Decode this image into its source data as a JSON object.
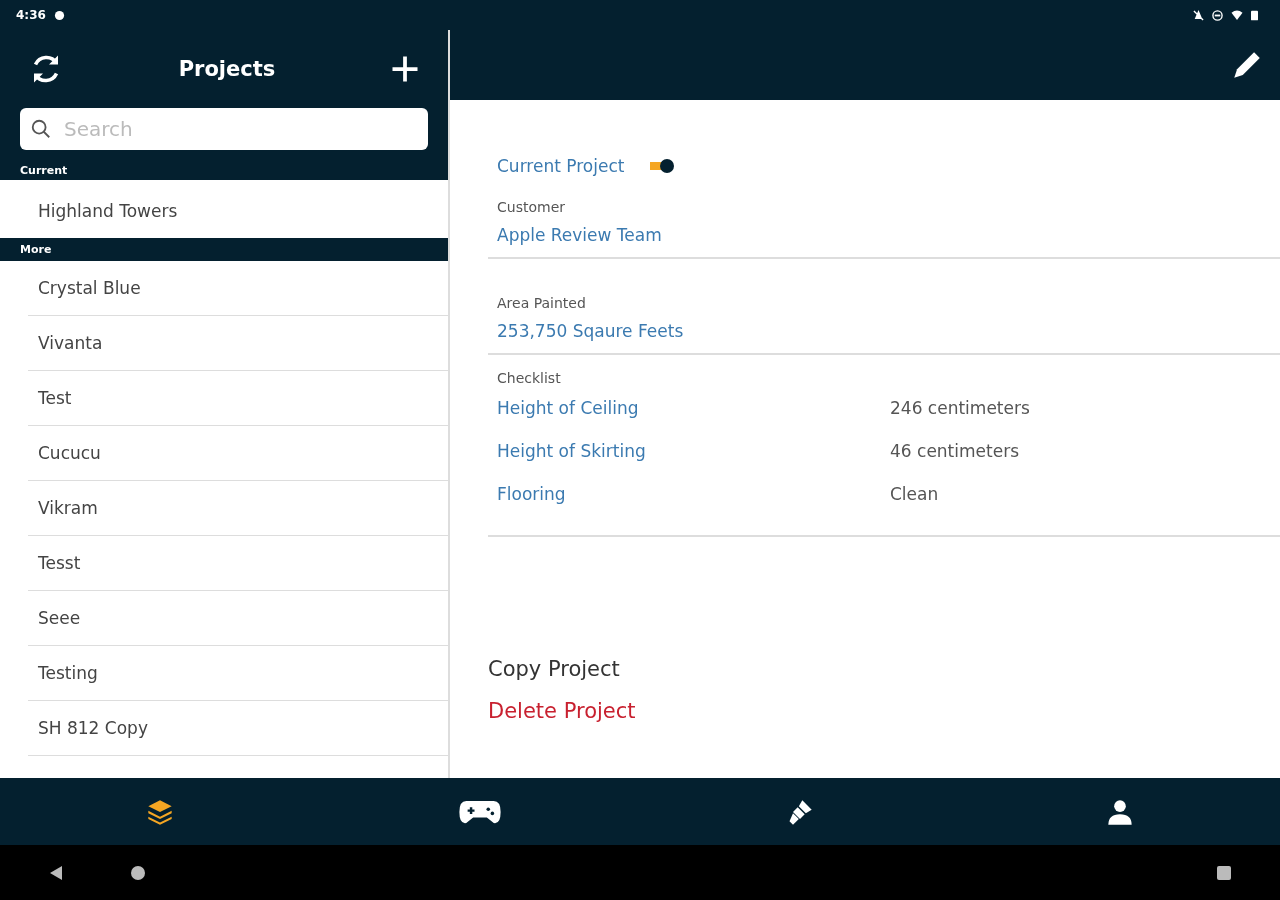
{
  "status_bar": {
    "time": "4:36"
  },
  "sidebar": {
    "title": "Projects",
    "search": {
      "placeholder": "Search"
    },
    "current_label": "Current",
    "current_item": "Highland Towers",
    "more_label": "More",
    "items": [
      "Crystal Blue",
      "Vivanta",
      "Test",
      "Cucucu",
      "Vikram",
      "Tesst",
      "Seee",
      "Testing",
      "SH 812 Copy"
    ]
  },
  "detail": {
    "current_project": {
      "label": "Current Project",
      "on": true
    },
    "fields": [
      {
        "label": "Customer",
        "value": "Apple Review Team"
      },
      {
        "label": "Area Painted",
        "value": "253,750 Sqaure Feets"
      }
    ],
    "checklist_label": "Checklist",
    "checklist": [
      {
        "name": "Height of Ceiling",
        "value": "246 centimeters"
      },
      {
        "name": "Height of Skirting",
        "value": "46 centimeters"
      },
      {
        "name": "Flooring",
        "value": "Clean"
      }
    ],
    "actions": [
      {
        "label": "Copy Project",
        "kind": "normal"
      },
      {
        "label": "Delete Project",
        "kind": "danger"
      }
    ]
  },
  "nav_tabs": [
    {
      "kind": "layers",
      "selected": true
    },
    {
      "kind": "gamepad",
      "selected": false
    },
    {
      "kind": "brush",
      "selected": false
    },
    {
      "kind": "person",
      "selected": false
    }
  ]
}
